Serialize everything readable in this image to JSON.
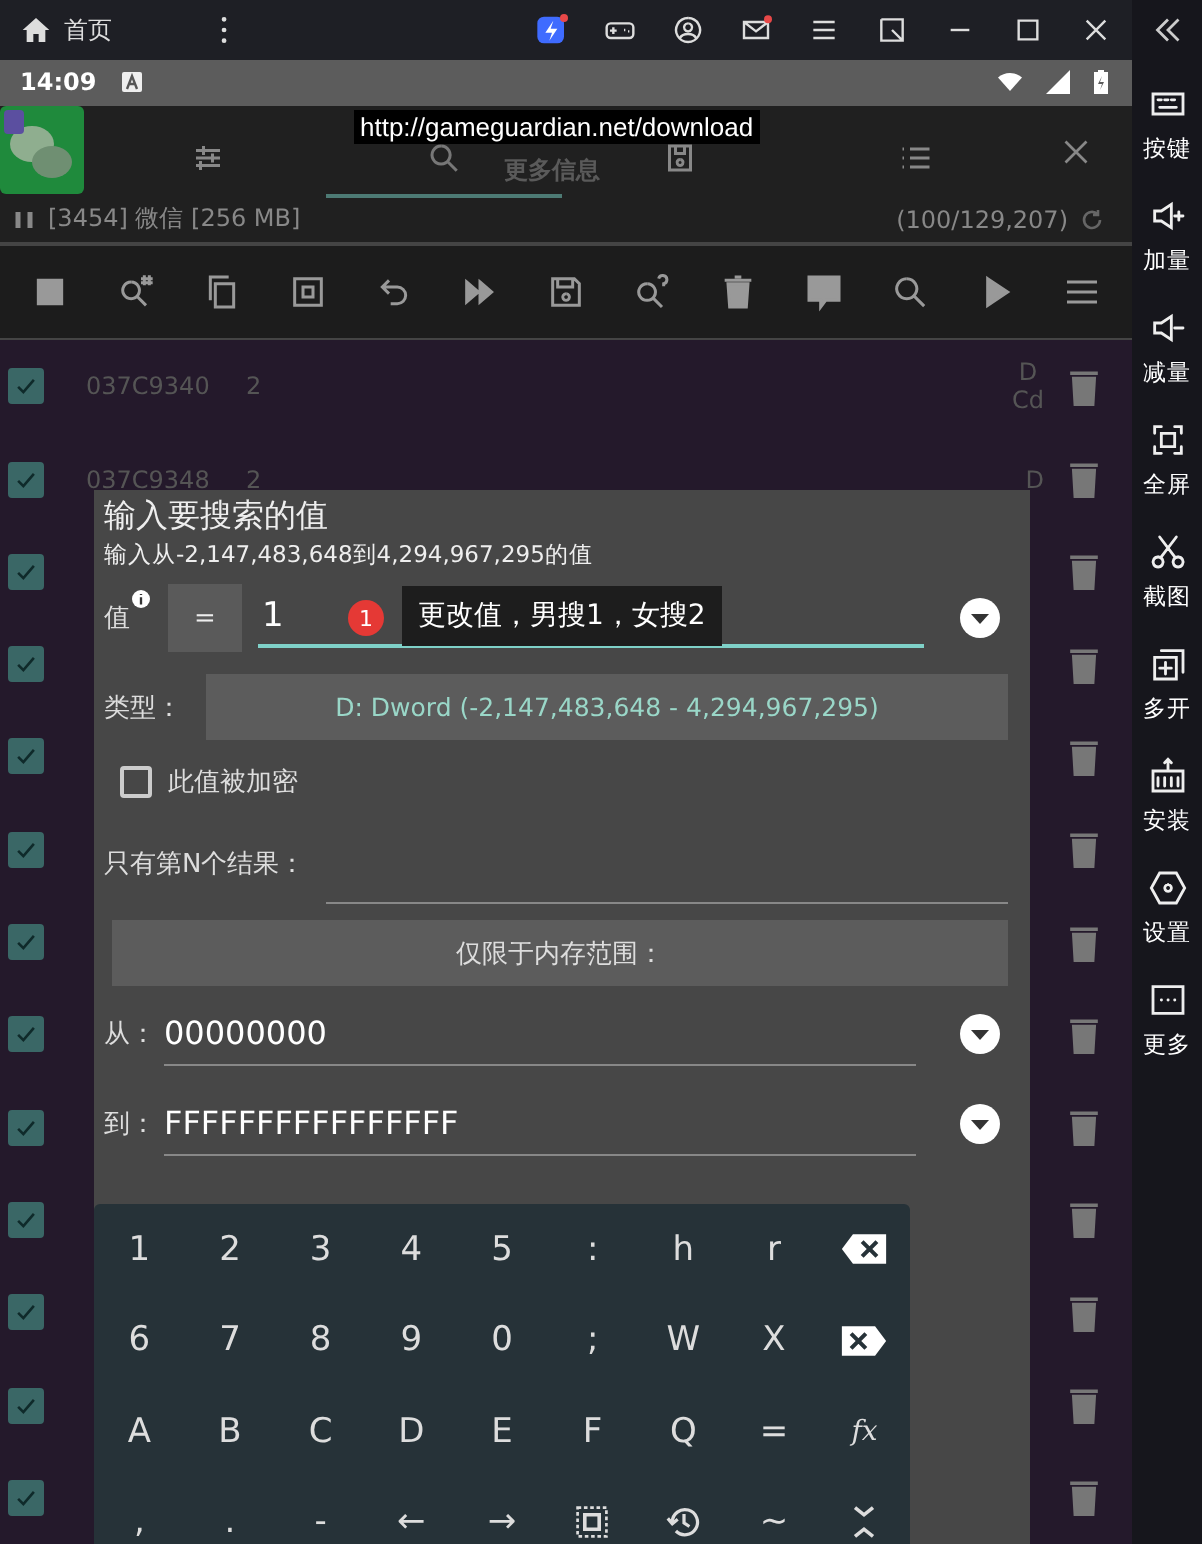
{
  "emulator_bar": {
    "home_label": "首页"
  },
  "sidebar": [
    "按键",
    "加量",
    "减量",
    "全屏",
    "截图",
    "多开",
    "安装",
    "设置",
    "更多"
  ],
  "status_bar": {
    "time": "14:09"
  },
  "url_tooltip": "http://gameguardian.net/download",
  "header": {
    "tabs": [
      {
        "selected": false
      },
      {
        "selected": true
      },
      {
        "selected": false
      },
      {
        "selected": false
      }
    ],
    "hint": "更多信息"
  },
  "process": {
    "label": "[3454] 微信 [256 MB]",
    "count": "(100/129,207)"
  },
  "rows": [
    {
      "checked": true,
      "address": "037C9340",
      "value": "2",
      "type": [
        "D",
        "Cd"
      ]
    },
    {
      "checked": true,
      "address": "037C9348",
      "value": "2",
      "type": [
        "D"
      ]
    },
    {
      "checked": true
    },
    {
      "checked": true
    },
    {
      "checked": true
    },
    {
      "checked": true
    },
    {
      "checked": true
    },
    {
      "checked": true
    },
    {
      "checked": true
    },
    {
      "checked": true
    },
    {
      "checked": true
    },
    {
      "checked": true
    },
    {
      "checked": true
    }
  ],
  "dialog": {
    "title": "输入要搜索的值",
    "subtitle": "输入从-2,147,483,648到4,294,967,295的值",
    "value_label": "值",
    "operator": "=",
    "value": "1",
    "badge": "1",
    "tip": "更改值，男搜1，女搜2",
    "type_label": "类型：",
    "type_value": "D: Dword (-2,147,483,648 - 4,294,967,295)",
    "encrypted": {
      "label": "此值被加密",
      "checked": false
    },
    "nth_label": "只有第N个结果：",
    "range_button": "仅限于内存范围：",
    "from_label": "从：",
    "from_value": "00000000",
    "to_label": "到：",
    "to_value": "FFFFFFFFFFFFFFFF"
  },
  "keyboard": [
    [
      {
        "kind": "char",
        "label": "1"
      },
      {
        "kind": "char",
        "label": "2"
      },
      {
        "kind": "char",
        "label": "3"
      },
      {
        "kind": "char",
        "label": "4"
      },
      {
        "kind": "char",
        "label": "5"
      },
      {
        "kind": "char",
        "label": ":"
      },
      {
        "kind": "char",
        "label": "h"
      },
      {
        "kind": "char",
        "label": "r"
      },
      {
        "kind": "backspace"
      }
    ],
    [
      {
        "kind": "char",
        "label": "6"
      },
      {
        "kind": "char",
        "label": "7"
      },
      {
        "kind": "char",
        "label": "8"
      },
      {
        "kind": "char",
        "label": "9"
      },
      {
        "kind": "char",
        "label": "0"
      },
      {
        "kind": "char",
        "label": ";"
      },
      {
        "kind": "char",
        "label": "W"
      },
      {
        "kind": "char",
        "label": "X"
      },
      {
        "kind": "clear"
      }
    ],
    [
      {
        "kind": "char",
        "label": "A"
      },
      {
        "kind": "char",
        "label": "B"
      },
      {
        "kind": "char",
        "label": "C"
      },
      {
        "kind": "char",
        "label": "D"
      },
      {
        "kind": "char",
        "label": "E"
      },
      {
        "kind": "char",
        "label": "F"
      },
      {
        "kind": "char",
        "label": "Q"
      },
      {
        "kind": "char",
        "label": "="
      },
      {
        "kind": "fx",
        "label": "fx"
      }
    ],
    [
      {
        "kind": "char",
        "label": ","
      },
      {
        "kind": "char",
        "label": "."
      },
      {
        "kind": "char",
        "label": "-"
      },
      {
        "kind": "char",
        "label": "←"
      },
      {
        "kind": "char",
        "label": "→"
      },
      {
        "kind": "select"
      },
      {
        "kind": "history"
      },
      {
        "kind": "char",
        "label": "~"
      },
      {
        "kind": "collapse"
      }
    ]
  ]
}
